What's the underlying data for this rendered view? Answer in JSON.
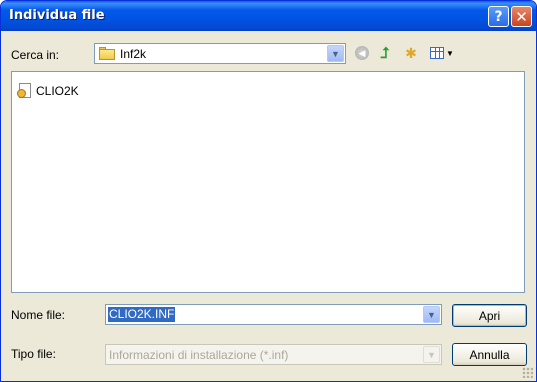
{
  "window": {
    "title": "Individua file",
    "help_button": "?",
    "close_button": "✕"
  },
  "toolbar": {
    "look_in_label": "Cerca in:",
    "look_in_value": "Inf2k",
    "icons": [
      "back-icon",
      "up-folder-icon",
      "new-folder-icon",
      "views-menu-icon"
    ]
  },
  "file_list": {
    "items": [
      {
        "name": "CLIO2K",
        "icon": "setup-information-file-icon"
      }
    ]
  },
  "file_name": {
    "label": "Nome file:",
    "value": "CLIO2K.INF"
  },
  "file_type": {
    "label": "Tipo file:",
    "value": "Informazioni di installazione (*.inf)"
  },
  "buttons": {
    "open": "Apri",
    "cancel": "Annulla"
  },
  "colors": {
    "titlebar": "#0054e3",
    "dialog_bg": "#ece9d8",
    "selection": "#316ac5"
  }
}
